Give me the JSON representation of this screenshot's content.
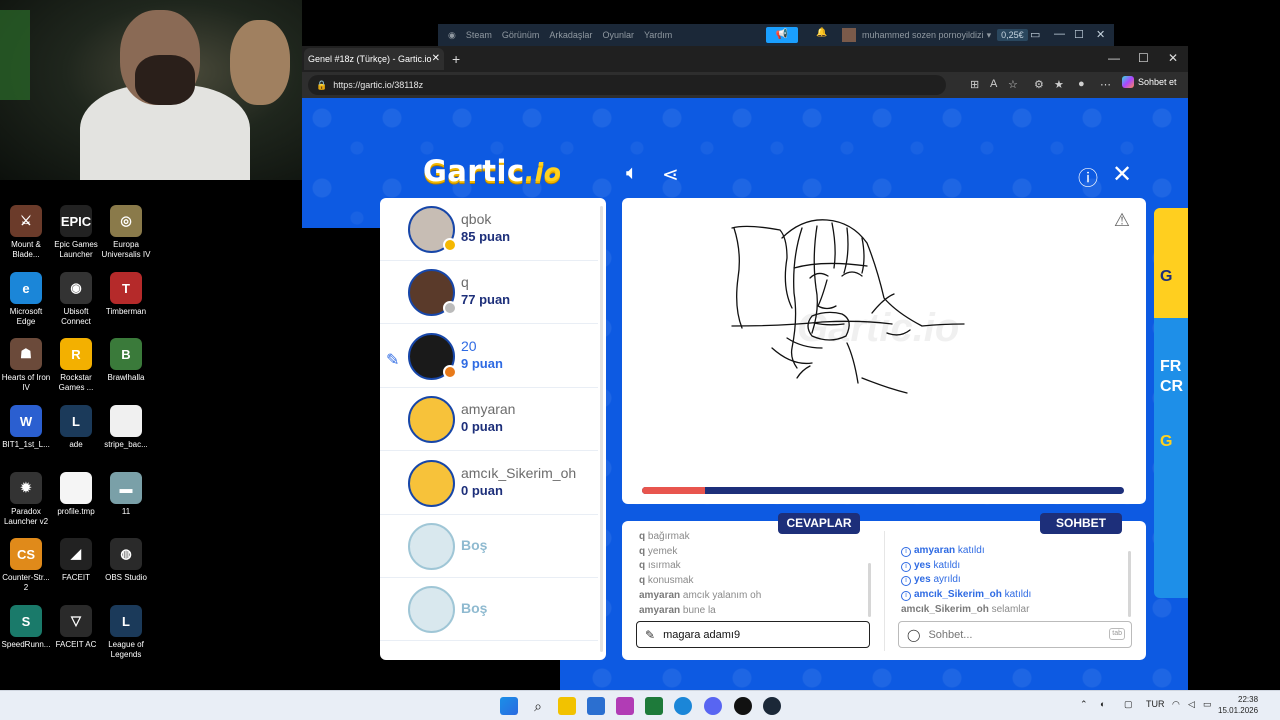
{
  "desktop": {
    "icons": [
      {
        "label": "Mount & Blade...",
        "color": "#6b3b2a",
        "glyph": "⚔"
      },
      {
        "label": "Epic Games Launcher",
        "color": "#222222",
        "glyph": "EPIC"
      },
      {
        "label": "Europa Universalis IV",
        "color": "#8a7a4a",
        "glyph": "◎"
      },
      {
        "label": "Microsoft Edge",
        "color": "#1b86d8",
        "glyph": "e"
      },
      {
        "label": "Ubisoft Connect",
        "color": "#333333",
        "glyph": "◉"
      },
      {
        "label": "Timberman",
        "color": "#b52a2a",
        "glyph": "T"
      },
      {
        "label": "Hearts of Iron IV",
        "color": "#6b4a3a",
        "glyph": "☗"
      },
      {
        "label": "Rockstar Games ...",
        "color": "#f3b000",
        "glyph": "R"
      },
      {
        "label": "Brawlhalla",
        "color": "#3a7a3a",
        "glyph": "B"
      },
      {
        "label": "BIT1_1st_L...",
        "color": "#2b5fd0",
        "glyph": "W"
      },
      {
        "label": "ade",
        "color": "#1b3a5a",
        "glyph": "L"
      },
      {
        "label": "stripe_bac...",
        "color": "#f0f0f0",
        "glyph": ""
      },
      {
        "label": "Paradox Launcher v2",
        "color": "#333333",
        "glyph": "✹"
      },
      {
        "label": "profile.tmp",
        "color": "#f5f5f5",
        "glyph": ""
      },
      {
        "label": "11",
        "color": "#7aa0a8",
        "glyph": "▬"
      },
      {
        "label": "Counter-Str... 2",
        "color": "#e08a1a",
        "glyph": "CS"
      },
      {
        "label": "FACEIT",
        "color": "#222222",
        "glyph": "◢"
      },
      {
        "label": "OBS Studio",
        "color": "#2a2a2a",
        "glyph": "◍"
      },
      {
        "label": "SpeedRunn...",
        "color": "#1a7a6a",
        "glyph": "S"
      },
      {
        "label": "FACEIT AC",
        "color": "#2a2a2a",
        "glyph": "▽"
      },
      {
        "label": "League of Legends",
        "color": "#1b3a5a",
        "glyph": "L"
      }
    ]
  },
  "steam": {
    "menu": [
      "Steam",
      "Görünüm",
      "Arkadaşlar",
      "Oyunlar",
      "Yardım"
    ],
    "username": "muhammed sozen pornoyildizi",
    "balance": "0,25€"
  },
  "browser": {
    "tab_title": "Genel #18z (Türkçe) - Gartic.io",
    "url": "https://gartic.io/38118z",
    "copilot_label": "Sohbet et"
  },
  "game": {
    "logo": "Gartic",
    "logo_suffix": ".io",
    "players": [
      {
        "name": "qbok",
        "points": "85 puan",
        "avatar_color": "#c7bdb4",
        "badge_color": "#f5b800",
        "drawing": false
      },
      {
        "name": "q",
        "points": "77 puan",
        "avatar_color": "#5a3a2a",
        "badge_color": "#bbbbbb",
        "drawing": false
      },
      {
        "name": "20",
        "points": "9 puan",
        "avatar_color": "#1a1a1a",
        "badge_color": "#e87a1a",
        "drawing": true
      },
      {
        "name": "amyaran",
        "points": "0 puan",
        "avatar_color": "#f7c23a",
        "badge_color": "",
        "drawing": false
      },
      {
        "name": "amcık_Sikerim_oh",
        "points": "0 puan",
        "avatar_color": "#f7c23a",
        "badge_color": "",
        "drawing": false
      }
    ],
    "empty_slots": [
      "Boş",
      "Boş"
    ],
    "timer_progress": 0.13,
    "answers_label": "CEVAPLAR",
    "chat_label": "SOHBET",
    "answers": [
      {
        "user": "q",
        "text": "bağırmak"
      },
      {
        "user": "q",
        "text": "yemek"
      },
      {
        "user": "q",
        "text": "ısırmak"
      },
      {
        "user": "q",
        "text": "konusmak"
      },
      {
        "user": "amyaran",
        "text": "amcık yalanım oh"
      },
      {
        "user": "amyaran",
        "text": "bune la"
      }
    ],
    "chat": [
      {
        "user": "amyaran",
        "text": "katıldı",
        "system": true
      },
      {
        "user": "yes",
        "text": "katıldı",
        "system": true
      },
      {
        "user": "yes",
        "text": "ayrıldı",
        "system": true
      },
      {
        "user": "amcık_Sikerim_oh",
        "text": "katıldı",
        "system": true
      },
      {
        "user": "amcık_Sikerim_oh",
        "text": "selamlar",
        "system": false
      }
    ],
    "answer_input_value": "magara adamı9",
    "chat_placeholder": "Sohbet...",
    "chat_tab_hint": "tab"
  },
  "taskbar": {
    "language": "TUR",
    "time": "22:38",
    "date": "15.01.2026"
  }
}
